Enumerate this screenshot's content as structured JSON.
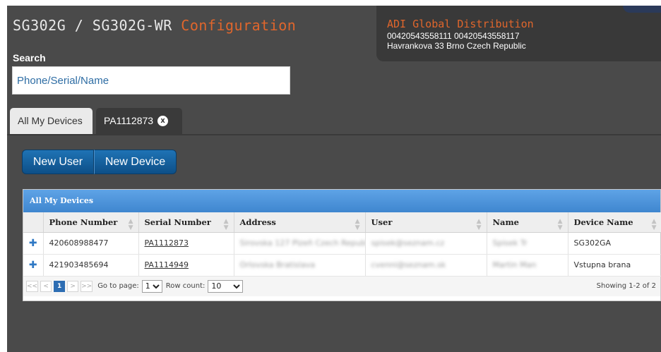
{
  "header": {
    "title_main": "SG302G / SG302G-WR ",
    "title_accent": "Configuration",
    "distributor_name": "ADI Global Distribution",
    "distributor_phone": "00420543558111 00420543558117",
    "distributor_address": "Havrankova 33 Brno Czech Republic"
  },
  "search": {
    "label": "Search",
    "placeholder": "Phone/Serial/Name",
    "value": ""
  },
  "tabs": [
    {
      "label": "All My Devices",
      "active": true
    },
    {
      "label": "PA1112873",
      "close": "x"
    }
  ],
  "toolbar": {
    "new_user": "New User",
    "new_device": "New Device"
  },
  "grid": {
    "caption": "All My Devices",
    "columns": [
      "Phone Number",
      "Serial Number",
      "Address",
      "User",
      "Name",
      "Device Name"
    ],
    "rows": [
      {
        "expand": "✚",
        "phone": "420608988477",
        "serial": "PA1112873",
        "address": "Sirovska 127 Plzeň Czech Republic",
        "user": "spisek@seznam.cz",
        "name": "Spisek Tr",
        "device": "SG302GA"
      },
      {
        "expand": "✚",
        "phone": "421903485694",
        "serial": "PA1114949",
        "address": "Orlovska Bratislava",
        "user": "cvenni@seznam.sk",
        "name": "Martin Man",
        "device": "Vstupna brana"
      }
    ]
  },
  "pager": {
    "first": "<<",
    "prev": "<",
    "current_page": "1",
    "next": ">",
    "last": ">>",
    "goto_label": "Go to page:",
    "goto_value": "1",
    "rowcount_label": "Row count:",
    "rowcount_value": "10",
    "showing": "Showing 1-2 of 2"
  },
  "colors": {
    "accent": "#e0662c",
    "brand_blue": "#1f73b5",
    "link_text": "#2e6da4"
  }
}
